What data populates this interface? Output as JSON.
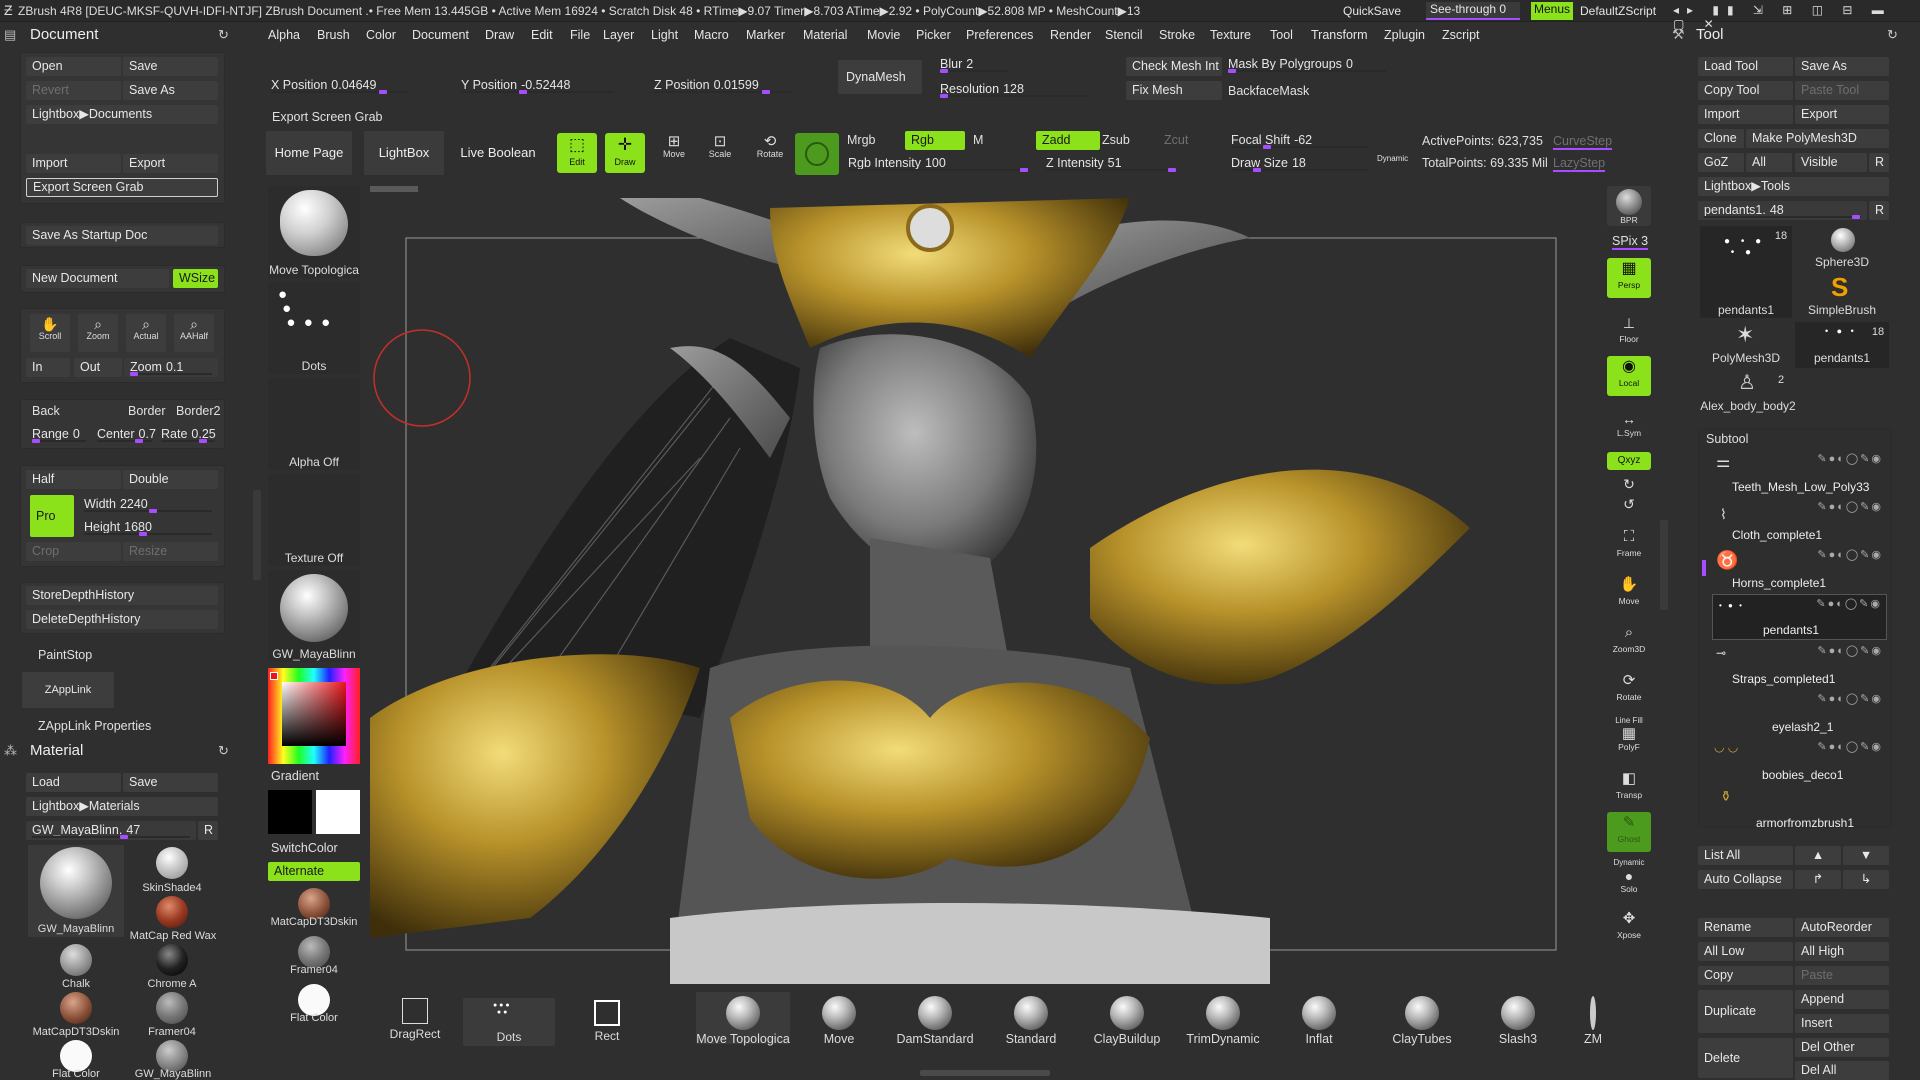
{
  "titlebar": {
    "text": "ZBrush 4R8 [DEUC-MKSF-QUVH-IDFI-NTJF]   ZBrush Document    .• Free Mem 13.445GB • Active Mem 16924 • Scratch Disk 48 • RTime▶9.07 Timer▶8.703 ATime▶2.92 • PolyCount▶52.808 MP • MeshCount▶13",
    "quicksave": "QuickSave",
    "seethrough": "See-through  0",
    "menus": "Menus",
    "script": "DefaultZScript"
  },
  "menubar": [
    "Alpha",
    "Brush",
    "Color",
    "Document",
    "Draw",
    "Edit",
    "File",
    "Layer",
    "Light",
    "Macro",
    "Marker",
    "Material",
    "Movie",
    "Picker",
    "Preferences",
    "Render",
    "Stencil",
    "Stroke",
    "Texture",
    "Tool",
    "Transform",
    "Zplugin",
    "Zscript"
  ],
  "doc": {
    "title": "Document",
    "open": "Open",
    "save": "Save",
    "revert": "Revert",
    "save_as": "Save As",
    "lightbox_docs": "Lightbox▶Documents",
    "import": "Import",
    "export": "Export",
    "export_grab": "Export Screen Grab",
    "save_startup": "Save As Startup Doc",
    "new_doc": "New Document",
    "wsize": "WSize",
    "scroll": "Scroll",
    "zoom": "Zoom",
    "actual": "Actual",
    "aahalf": "AAHalf",
    "in": "In",
    "out": "Out",
    "zoom_lbl": "Zoom",
    "zoom_val": "0.1",
    "back": "Back",
    "border": "Border",
    "border2": "Border2",
    "range_lbl": "Range",
    "range_val": "0",
    "center_lbl": "Center",
    "center_val": "0.7",
    "rate_lbl": "Rate",
    "rate_val": "0.25",
    "half": "Half",
    "double": "Double",
    "pro": "Pro",
    "width_lbl": "Width",
    "width_val": "2240",
    "height_lbl": "Height",
    "height_val": "1680",
    "crop": "Crop",
    "resize": "Resize",
    "store_depth": "StoreDepthHistory",
    "delete_depth": "DeleteDepthHistory",
    "paintstop": "PaintStop",
    "zapplink": "ZAppLink",
    "zapplink_props": "ZAppLink Properties"
  },
  "material": {
    "title": "Material",
    "load": "Load",
    "save": "Save",
    "lightbox": "Lightbox▶Materials",
    "current": "GW_MayaBlinn.",
    "current_val": "47",
    "r": "R",
    "items": [
      "GW_MayaBlinn",
      "SkinShade4",
      "MatCap Red Wax",
      "Chalk",
      "Chrome A",
      "MatCapDT3Dskin",
      "Framer04",
      "Flat Color",
      "GW_MayaBlinn"
    ]
  },
  "coords": {
    "x_lbl": "X Position",
    "x_val": "0.04649",
    "y_lbl": "Y Position",
    "y_val": "-0.52448",
    "z_lbl": "Z Position",
    "z_val": "0.01599",
    "dynamesh": "DynaMesh",
    "blur_lbl": "Blur",
    "blur_val": "2",
    "res_lbl": "Resolution",
    "res_val": "128",
    "check_mesh": "Check Mesh Int",
    "fix_mesh": "Fix Mesh",
    "mask_lbl": "Mask By Polygroups",
    "mask_val": "0",
    "backface": "BackfaceMask",
    "export_tip": "Export Screen Grab"
  },
  "toolbar": {
    "home": "Home Page",
    "lightbox": "LightBox",
    "live_boolean": "Live Boolean",
    "edit": "Edit",
    "draw": "Draw",
    "move": "Move",
    "scale": "Scale",
    "rotate": "Rotate",
    "mrgb": "Mrgb",
    "rgb": "Rgb",
    "m": "M",
    "zadd": "Zadd",
    "zsub": "Zsub",
    "zcut": "Zcut",
    "rgb_int_lbl": "Rgb Intensity",
    "rgb_int_val": "100",
    "z_int_lbl": "Z Intensity",
    "z_int_val": "51",
    "focal_lbl": "Focal Shift",
    "focal_val": "-62",
    "draw_size_lbl": "Draw Size",
    "draw_size_val": "18",
    "dynamic": "Dynamic",
    "active_points": "ActivePoints: 623,735",
    "total_points": "TotalPoints: 69.335 Mil",
    "curve_step": "CurveStep",
    "lazy_step": "LazyStep"
  },
  "leftshelf": {
    "brush": "Move Topologica",
    "stroke": "Dots",
    "alpha": "Alpha Off",
    "texture": "Texture Off",
    "material": "GW_MayaBlinn",
    "gradient": "Gradient",
    "switch_color": "SwitchColor",
    "alternate": "Alternate",
    "mat1": "MatCapDT3Dskin",
    "mat2": "Framer04",
    "mat3": "Flat Color"
  },
  "rightshelf": {
    "bpr": "BPR",
    "spix": "SPix 3",
    "persp": "Persp",
    "floor": "Floor",
    "local": "Local",
    "lsym": "L.Sym",
    "xyz": "Qxyz",
    "frame": "Frame",
    "move": "Move",
    "zoom3d": "Zoom3D",
    "rotate": "Rotate",
    "linefill": "Line Fill",
    "polyf": "PolyF",
    "transp": "Transp",
    "ghost": "Ghost",
    "dynamic": "Dynamic",
    "solo": "Solo",
    "xpose": "Xpose"
  },
  "bottom": {
    "dragrect": "DragRect",
    "dots": "Dots",
    "rect": "Rect",
    "brushes": [
      "Move Topologica",
      "Move",
      "DamStandard",
      "Standard",
      "ClayBuildup",
      "TrimDynamic",
      "Inflat",
      "ClayTubes",
      "Slash3",
      "ZM"
    ]
  },
  "tool": {
    "title": "Tool",
    "load": "Load Tool",
    "save_as": "Save As",
    "copy": "Copy Tool",
    "paste": "Paste Tool",
    "import": "Import",
    "export": "Export",
    "clone": "Clone",
    "make_poly": "Make PolyMesh3D",
    "goz": "GoZ",
    "all": "All",
    "visible": "Visible",
    "r": "R",
    "lightbox": "Lightbox▶Tools",
    "current": "pendants1.",
    "current_val": "48",
    "thumbs": [
      {
        "name": "pendants1",
        "count": "18"
      },
      {
        "name": "Sphere3D",
        "count": ""
      },
      {
        "name": "SimpleBrush",
        "count": ""
      },
      {
        "name": "PolyMesh3D",
        "count": ""
      },
      {
        "name": "pendants1",
        "count": "18"
      },
      {
        "name": "Alex_body_body2",
        "count": "2"
      }
    ],
    "subtool_title": "Subtool",
    "subtools": [
      "Teeth_Mesh_Low_Poly33",
      "Cloth_complete1",
      "Horns_complete1",
      "pendants1",
      "Straps_completed1",
      "eyelash2_1",
      "boobies_deco1",
      "armorfromzbrush1"
    ],
    "list_all": "List All",
    "auto_collapse": "Auto Collapse",
    "rename": "Rename",
    "autoreorder": "AutoReorder",
    "all_low": "All Low",
    "all_high": "All High",
    "copy2": "Copy",
    "paste2": "Paste",
    "duplicate": "Duplicate",
    "append": "Append",
    "insert": "Insert",
    "delete": "Delete",
    "del_other": "Del Other",
    "del_all": "Del All"
  },
  "colors": {
    "green": "#8be21b",
    "purple": "#a64dff",
    "bg": "#2f2f2f",
    "panel": "#353535",
    "gold": "#c9a534"
  }
}
